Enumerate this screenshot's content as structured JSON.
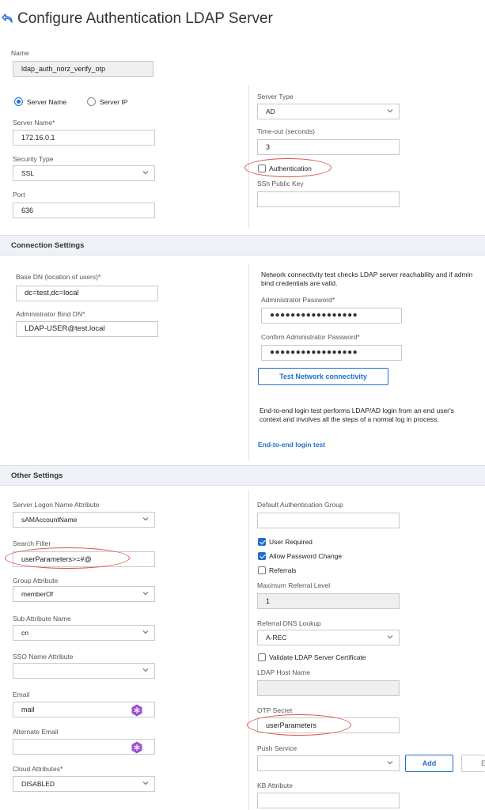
{
  "header": {
    "title": "Configure Authentication LDAP Server"
  },
  "basic": {
    "name_label": "Name",
    "name_value": "ldap_auth_norz_verify_otp",
    "radio_server_name": "Server Name",
    "radio_server_ip": "Server IP",
    "radio_selected": "Server Name",
    "server_name_label": "Server Name*",
    "server_name_value": "172.16.0.1",
    "security_type_label": "Security Type",
    "security_type_value": "SSL",
    "port_label": "Port",
    "port_value": "636",
    "server_type_label": "Server Type",
    "server_type_value": "AD",
    "timeout_label": "Time-out (seconds)",
    "timeout_value": "3",
    "authentication_label": "Authentication",
    "authentication_checked": false,
    "ssh_key_label": "SSh Public Key",
    "ssh_key_value": ""
  },
  "connection": {
    "section_title": "Connection Settings",
    "base_dn_label": "Base DN (location of users)*",
    "base_dn_value": "dc=test,dc=local",
    "bind_dn_label": "Administrator Bind DN*",
    "bind_dn_value": "LDAP-USER@test.local",
    "network_note": "Network connectivity test checks LDAP server reachability and if admin bind credentials are valid.",
    "admin_pw_label": "Administrator Password*",
    "admin_pw_value": "●●●●●●●●●●●●●●●●●",
    "confirm_pw_label": "Confirm Administrator Password*",
    "confirm_pw_value": "●●●●●●●●●●●●●●●●●",
    "test_button": "Test Network connectivity",
    "e2e_note": "End-to-end login test performs LDAP/AD login from an end user's context and involves all the steps of a normal log in process.",
    "e2e_link": "End-to-end login test"
  },
  "other": {
    "section_title": "Other Settings",
    "logon_attr_label": "Server Logon Name Attribute",
    "logon_attr_value": "sAMAccountName",
    "search_filter_label": "Search Filter",
    "search_filter_value": "userParameters>=#@",
    "group_attr_label": "Group Attribute",
    "group_attr_value": "memberOf",
    "sub_attr_label": "Sub Attribute Name",
    "sub_attr_value": "cn",
    "sso_label": "SSO Name Attribute",
    "sso_value": "",
    "email_label": "Email",
    "email_value": "mail",
    "alt_email_label": "Alternate Email",
    "alt_email_value": "",
    "cloud_attr_label": "Cloud Attributes*",
    "cloud_attr_value": "DISABLED",
    "default_group_label": "Default Authentication Group",
    "default_group_value": "",
    "user_required_label": "User Required",
    "user_required_checked": true,
    "allow_pw_change_label": "Allow Password Change",
    "allow_pw_change_checked": true,
    "referrals_label": "Referrals",
    "referrals_checked": false,
    "max_referral_label": "Maximum Referral Level",
    "max_referral_value": "1",
    "referral_dns_label": "Referral DNS Lookup",
    "referral_dns_value": "A-REC",
    "validate_cert_label": "Validate LDAP Server Certificate",
    "validate_cert_checked": false,
    "ldap_host_label": "LDAP Host Name",
    "ldap_host_value": "",
    "otp_label": "OTP Secret",
    "otp_value": "userParameters",
    "push_label": "Push Service",
    "push_value": "",
    "add_button": "Add",
    "edit_button": "Ed",
    "kb_label": "KB Attribute",
    "kb_value": ""
  },
  "colors": {
    "accent": "#1f6fd0",
    "highlight_ellipse": "#d9534f",
    "section_bg": "#eef1f6",
    "key_icon": "#9b4fd6"
  }
}
